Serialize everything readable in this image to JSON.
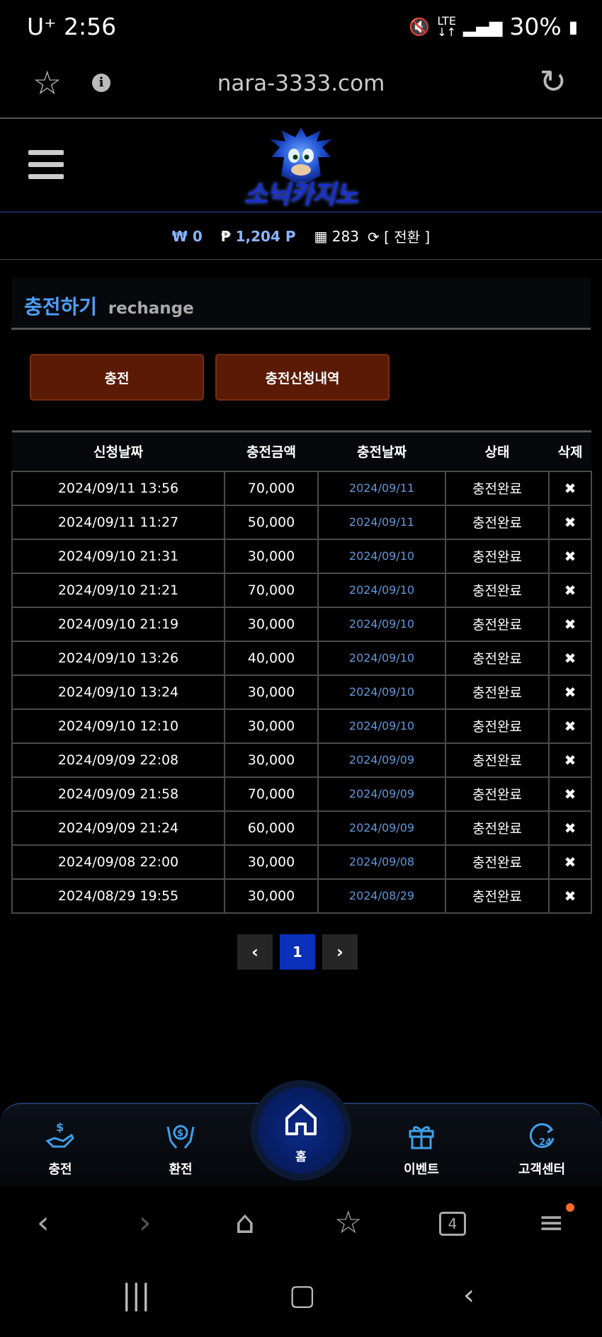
{
  "status_bar": {
    "carrier": "U⁺ 2:56",
    "battery": "30%",
    "icons": [
      "mute-icon",
      "lte-icon",
      "signal-icon",
      "battery-icon"
    ]
  },
  "browser": {
    "url": "nara-3333.com"
  },
  "site": {
    "logo_text": "소닉카지노"
  },
  "wallet": {
    "won_symbol": "₩",
    "won_value": "0",
    "point_symbol": "₱",
    "point_value": "1,204 P",
    "chip_value": "283",
    "convert_label": "[ 전환 ]"
  },
  "section": {
    "title": "충전하기",
    "subtitle": "rechange"
  },
  "tabs": {
    "charge": "충전",
    "history": "충전신청내역"
  },
  "table": {
    "headers": [
      "신청날짜",
      "충전금액",
      "충전날짜",
      "상태",
      "삭제"
    ],
    "rows": [
      {
        "request_date": "2024/09/11 13:56",
        "amount": "70,000",
        "charge_date": "2024/09/11",
        "status": "충전완료",
        "delete": "✖"
      },
      {
        "request_date": "2024/09/11 11:27",
        "amount": "50,000",
        "charge_date": "2024/09/11",
        "status": "충전완료",
        "delete": "✖"
      },
      {
        "request_date": "2024/09/10 21:31",
        "amount": "30,000",
        "charge_date": "2024/09/10",
        "status": "충전완료",
        "delete": "✖"
      },
      {
        "request_date": "2024/09/10 21:21",
        "amount": "70,000",
        "charge_date": "2024/09/10",
        "status": "충전완료",
        "delete": "✖"
      },
      {
        "request_date": "2024/09/10 21:19",
        "amount": "30,000",
        "charge_date": "2024/09/10",
        "status": "충전완료",
        "delete": "✖"
      },
      {
        "request_date": "2024/09/10 13:26",
        "amount": "40,000",
        "charge_date": "2024/09/10",
        "status": "충전완료",
        "delete": "✖"
      },
      {
        "request_date": "2024/09/10 13:24",
        "amount": "30,000",
        "charge_date": "2024/09/10",
        "status": "충전완료",
        "delete": "✖"
      },
      {
        "request_date": "2024/09/10 12:10",
        "amount": "30,000",
        "charge_date": "2024/09/10",
        "status": "충전완료",
        "delete": "✖"
      },
      {
        "request_date": "2024/09/09 22:08",
        "amount": "30,000",
        "charge_date": "2024/09/09",
        "status": "충전완료",
        "delete": "✖"
      },
      {
        "request_date": "2024/09/09 21:58",
        "amount": "70,000",
        "charge_date": "2024/09/09",
        "status": "충전완료",
        "delete": "✖"
      },
      {
        "request_date": "2024/09/09 21:24",
        "amount": "60,000",
        "charge_date": "2024/09/09",
        "status": "충전완료",
        "delete": "✖"
      },
      {
        "request_date": "2024/09/08 22:00",
        "amount": "30,000",
        "charge_date": "2024/09/08",
        "status": "충전완료",
        "delete": "✖"
      },
      {
        "request_date": "2024/08/29 19:55",
        "amount": "30,000",
        "charge_date": "2024/08/29",
        "status": "충전완료",
        "delete": "✖"
      }
    ]
  },
  "pagination": {
    "prev": "‹",
    "current": "1",
    "next": "›"
  },
  "bottom_menu": {
    "charge": "충전",
    "exchange": "환전",
    "home": "홈",
    "event": "이벤트",
    "support": "고객센터"
  },
  "browser_nav": {
    "tab_count": "4"
  },
  "colors": {
    "accent_blue": "#4da1ff",
    "tab_button": "#5a1a05",
    "page_current": "#0a2fb8",
    "charge_date_text": "#5e97d8"
  }
}
